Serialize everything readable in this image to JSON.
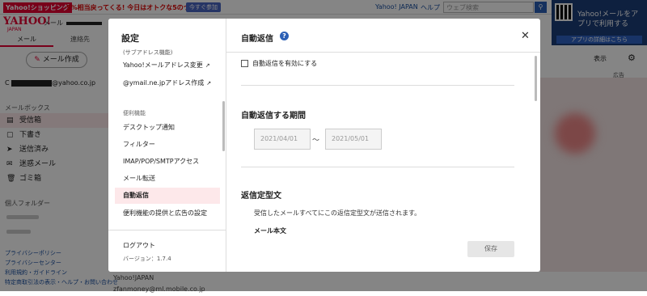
{
  "topbar": {
    "promo_shop": "Yahoo!ショッピング",
    "promo_text": "5%相当戻ってくる! 今日はオトクな5のつく日",
    "promo_join": "今すぐ参加",
    "yj_link": "Yahoo! JAPAN",
    "help_link": "ヘルプ",
    "web_search_placeholder": "ウェブ検索"
  },
  "app_promo": {
    "text": "Yahoo!メールをアプリで利用する",
    "sub": "アプリストアへ移動",
    "cta": "アプリの詳細はこちら"
  },
  "logo": {
    "main": "YAHOO!",
    "sub": "JAPAN",
    "mail": "メール"
  },
  "nav_tabs": {
    "mail": "メール",
    "address": "連絡先"
  },
  "compose_label": "メール作成",
  "account_suffix": "@yahoo.co.jp",
  "mailbox_title": "メールボックス",
  "folders": [
    {
      "label": "受信箱",
      "icon": "inbox-icon"
    },
    {
      "label": "下書き",
      "icon": "draft-icon"
    },
    {
      "label": "送信済み",
      "icon": "sent-icon"
    },
    {
      "label": "迷惑メール",
      "icon": "spam-icon"
    },
    {
      "label": "ゴミ箱",
      "icon": "trash-icon"
    }
  ],
  "personal_folders_title": "個人フォルダー",
  "footer_links": [
    "プライバシーポリシー",
    "プライバシーセンター",
    "利用規約・ガイドライン",
    "特定商取引法の表示・ヘルプ・お問い合わせ"
  ],
  "right_toolbar": {
    "view": "表示"
  },
  "ad_label": "広告",
  "bg_rows": [
    "Yahoo!JAPAN",
    "zfanmoney@ml.mobile.co.jp"
  ],
  "modal": {
    "sidebar": {
      "title": "設定",
      "items_top": [
        "(サブアドレス機能)",
        "Yahoo!メールアドレス変更",
        "@ymail.ne.jpアドレス作成"
      ],
      "section_label": "便利機能",
      "items": [
        "デスクトップ通知",
        "フィルター",
        "IMAP/POP/SMTPアクセス",
        "メール転送",
        "自動返信",
        "便利機能の提供と広告の設定"
      ],
      "logout": "ログアウト",
      "version": "バージョン：1.7.4"
    },
    "main": {
      "title": "自動返信",
      "enable_label": "自動返信を有効にする",
      "period_title": "自動返信する期間",
      "start_date": "2021/04/01",
      "end_date": "2021/05/01",
      "tilde": "～",
      "template_title": "返信定型文",
      "template_desc": "受信したメールすべてにこの返信定型文が送信されます。",
      "body_label": "メール本文",
      "save_label": "保存"
    }
  },
  "colors": {
    "brand": "#e60033",
    "accent": "#2b5fb5",
    "selected_bg": "#fde8ea"
  }
}
